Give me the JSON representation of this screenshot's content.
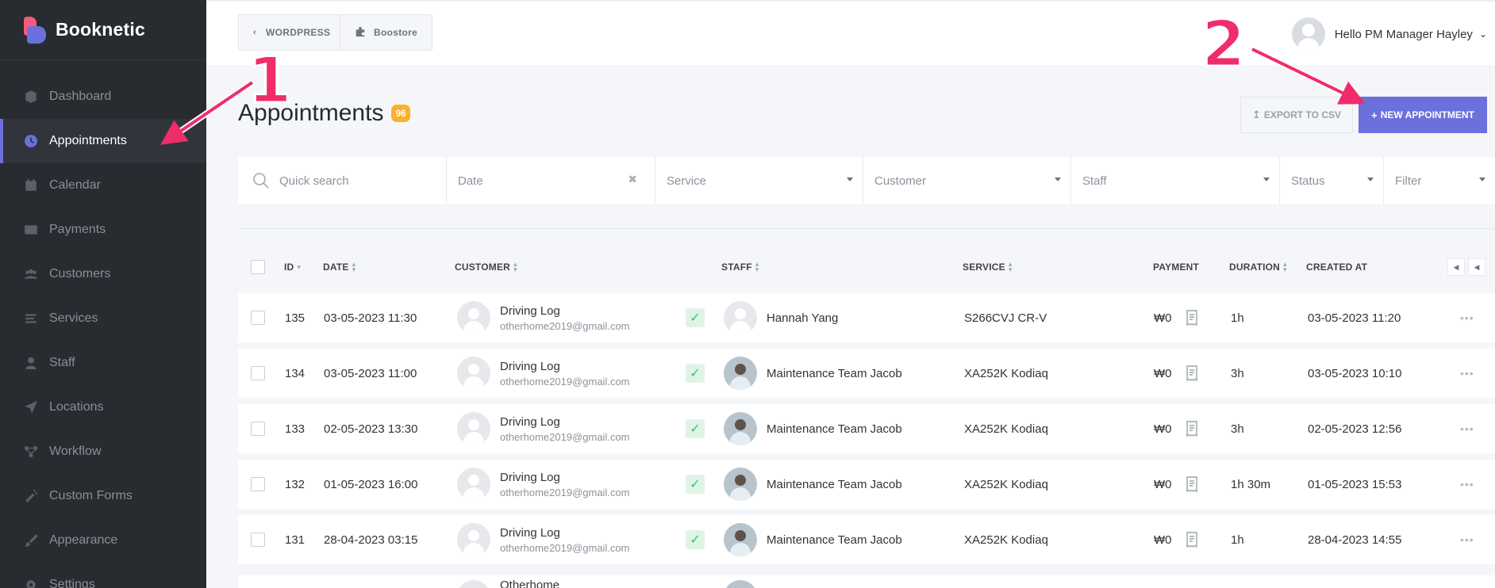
{
  "app": {
    "name": "Booknetic"
  },
  "sidebar": {
    "items": [
      {
        "label": "Dashboard",
        "icon": "cube-icon",
        "active": false
      },
      {
        "label": "Appointments",
        "icon": "clock-icon",
        "active": true
      },
      {
        "label": "Calendar",
        "icon": "calendar-icon",
        "active": false
      },
      {
        "label": "Payments",
        "icon": "credit-card-icon",
        "active": false
      },
      {
        "label": "Customers",
        "icon": "users-icon",
        "active": false
      },
      {
        "label": "Services",
        "icon": "list-icon",
        "active": false
      },
      {
        "label": "Staff",
        "icon": "user-icon",
        "active": false
      },
      {
        "label": "Locations",
        "icon": "location-arrow-icon",
        "active": false
      },
      {
        "label": "Workflow",
        "icon": "workflow-icon",
        "active": false
      },
      {
        "label": "Custom Forms",
        "icon": "magic-wand-icon",
        "active": false
      },
      {
        "label": "Appearance",
        "icon": "brush-icon",
        "active": false
      },
      {
        "label": "Settings",
        "icon": "gear-icon",
        "active": false
      }
    ]
  },
  "topbar": {
    "wordpress_label": "WORDPRESS",
    "boostore_label": "Boostore",
    "user_greeting": "Hello PM Manager Hayley"
  },
  "page": {
    "title": "Appointments",
    "count": "96",
    "export_label": "EXPORT TO CSV",
    "new_label": "NEW APPOINTMENT"
  },
  "filters": {
    "search_placeholder": "Quick search",
    "date": "Date",
    "service": "Service",
    "customer": "Customer",
    "staff": "Staff",
    "status": "Status",
    "filter": "Filter"
  },
  "table": {
    "columns": {
      "id": "ID",
      "date": "DATE",
      "customer": "CUSTOMER",
      "staff": "STAFF",
      "service": "SERVICE",
      "payment": "PAYMENT",
      "duration": "DURATION",
      "created_at": "CREATED AT"
    },
    "rows": [
      {
        "id": "135",
        "date": "03-05-2023 11:30",
        "customer_name": "Driving Log",
        "customer_email": "otherhome2019@gmail.com",
        "staff": "Hannah Yang",
        "staff_photo": false,
        "service": "S266CVJ CR-V",
        "payment": "₩0",
        "duration": "1h",
        "created_at": "03-05-2023 11:20"
      },
      {
        "id": "134",
        "date": "03-05-2023 11:00",
        "customer_name": "Driving Log",
        "customer_email": "otherhome2019@gmail.com",
        "staff": "Maintenance Team Jacob",
        "staff_photo": true,
        "service": "XA252K Kodiaq",
        "payment": "₩0",
        "duration": "3h",
        "created_at": "03-05-2023 10:10"
      },
      {
        "id": "133",
        "date": "02-05-2023 13:30",
        "customer_name": "Driving Log",
        "customer_email": "otherhome2019@gmail.com",
        "staff": "Maintenance Team Jacob",
        "staff_photo": true,
        "service": "XA252K Kodiaq",
        "payment": "₩0",
        "duration": "3h",
        "created_at": "02-05-2023 12:56"
      },
      {
        "id": "132",
        "date": "01-05-2023 16:00",
        "customer_name": "Driving Log",
        "customer_email": "otherhome2019@gmail.com",
        "staff": "Maintenance Team Jacob",
        "staff_photo": true,
        "service": "XA252K Kodiaq",
        "payment": "₩0",
        "duration": "1h 30m",
        "created_at": "01-05-2023 15:53"
      },
      {
        "id": "131",
        "date": "28-04-2023 03:15",
        "customer_name": "Driving Log",
        "customer_email": "otherhome2019@gmail.com",
        "staff": "Maintenance Team Jacob",
        "staff_photo": true,
        "service": "XA252K Kodiaq",
        "payment": "₩0",
        "duration": "1h",
        "created_at": "28-04-2023 14:55"
      }
    ],
    "partial_row_customer": "Otherhome"
  },
  "annotations": {
    "one": "1",
    "two": "2"
  },
  "colors": {
    "accent": "#6c70dc",
    "sidebar": "#282b30",
    "badge": "#fdb02b",
    "annotation": "#ef2d6a",
    "status_ok": "#3cbf6f"
  }
}
